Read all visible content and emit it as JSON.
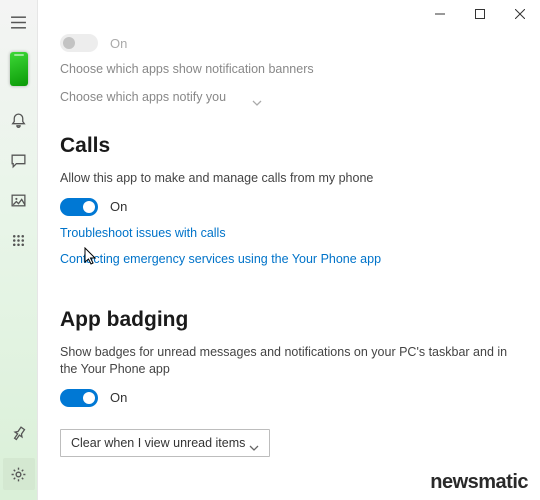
{
  "window": {
    "min": "minimize",
    "max": "maximize",
    "close": "close"
  },
  "sidebar": {
    "hamburger": "menu",
    "phone": "phone-device",
    "notifications": "notifications",
    "messages": "messages",
    "photos": "photos",
    "apps": "apps",
    "pin": "pin",
    "settings": "settings"
  },
  "notifications_section": {
    "toggle_state": "On",
    "banners_link": "Choose which apps show notification banners",
    "notify_link": "Choose which apps notify you"
  },
  "calls": {
    "heading": "Calls",
    "desc": "Allow this app to make and manage calls from my phone",
    "toggle_state": "On",
    "troubleshoot_link": "Troubleshoot issues with calls",
    "emergency_link": "Contacting emergency services using the Your Phone app"
  },
  "badging": {
    "heading": "App badging",
    "desc": "Show badges for unread messages and notifications on your PC's taskbar and in the Your Phone app",
    "toggle_state": "On",
    "dropdown_selected": "Clear when I view unread items"
  },
  "watermark": "newsmatic"
}
